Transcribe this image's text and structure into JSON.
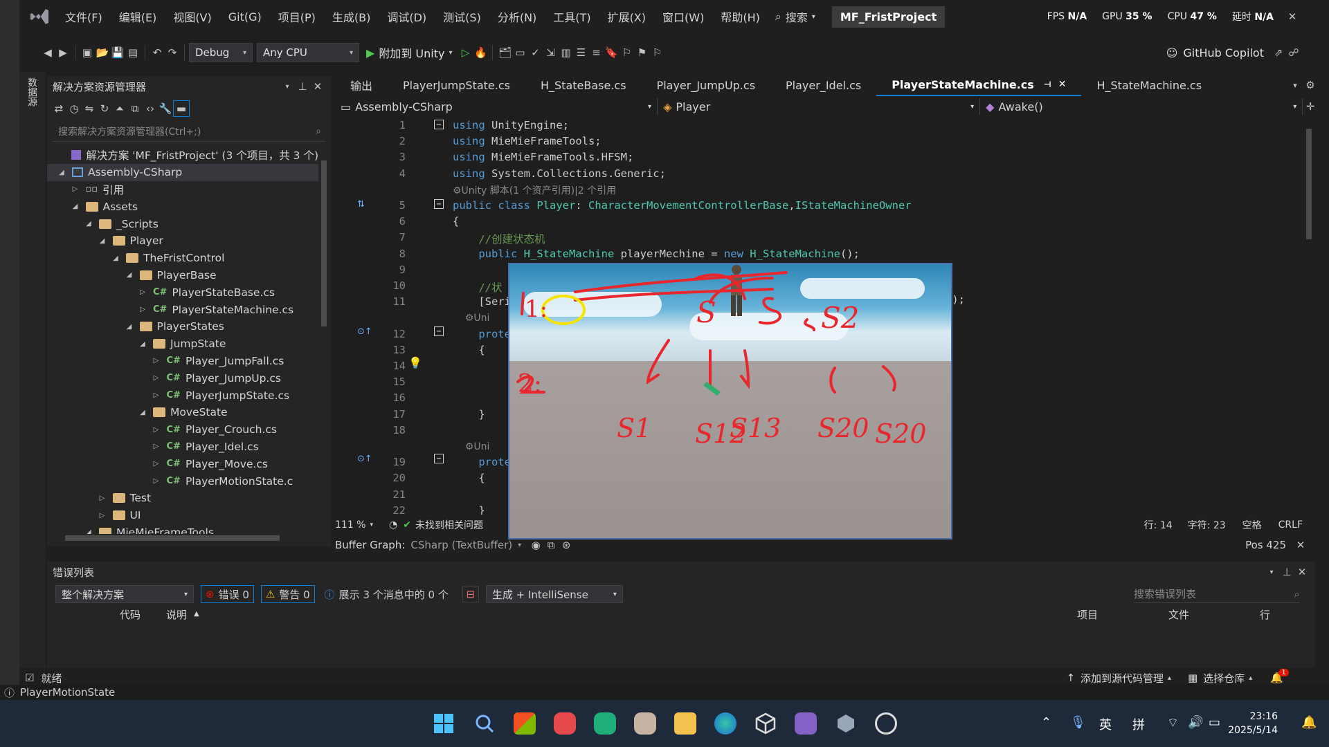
{
  "menubar": {
    "items": [
      "文件(F)",
      "编辑(E)",
      "视图(V)",
      "Git(G)",
      "项目(P)",
      "生成(B)",
      "调试(D)",
      "测试(S)",
      "分析(N)",
      "工具(T)",
      "扩展(X)",
      "窗口(W)",
      "帮助(H)"
    ],
    "search_label": "搜索",
    "project_name": "MF_FristProject",
    "perf": {
      "fps_label": "FPS",
      "fps": "N/A",
      "gpu_label": "GPU",
      "gpu": "35 %",
      "cpu_label": "CPU",
      "cpu": "47 %",
      "latency_label": "延时",
      "latency": "N/A"
    }
  },
  "toolbar": {
    "configuration": "Debug",
    "platform": "Any CPU",
    "attach_label": "附加到 Unity",
    "copilot_label": "GitHub Copilot"
  },
  "toolstrip": {
    "label": "数据源"
  },
  "solution_explorer": {
    "title": "解决方案资源管理器",
    "search_placeholder": "搜索解决方案资源管理器(Ctrl+;)",
    "tree": [
      {
        "label": "解决方案 'MF_FristProject' (3 个项目，共 3 个)",
        "depth": 0,
        "kind": "solution",
        "exp": ""
      },
      {
        "label": "Assembly-CSharp",
        "depth": 0,
        "kind": "project",
        "exp": "open",
        "selected": true
      },
      {
        "label": "引用",
        "depth": 1,
        "kind": "ref",
        "exp": "closed"
      },
      {
        "label": "Assets",
        "depth": 1,
        "kind": "folder",
        "exp": "open"
      },
      {
        "label": "_Scripts",
        "depth": 2,
        "kind": "folder",
        "exp": "open"
      },
      {
        "label": "Player",
        "depth": 3,
        "kind": "folder",
        "exp": "open"
      },
      {
        "label": "TheFristControl",
        "depth": 4,
        "kind": "folder",
        "exp": "open"
      },
      {
        "label": "PlayerBase",
        "depth": 5,
        "kind": "folder",
        "exp": "open"
      },
      {
        "label": "PlayerStateBase.cs",
        "depth": 6,
        "kind": "cs",
        "exp": "closed"
      },
      {
        "label": "PlayerStateMachine.cs",
        "depth": 6,
        "kind": "cs",
        "exp": "closed"
      },
      {
        "label": "PlayerStates",
        "depth": 5,
        "kind": "folder",
        "exp": "open"
      },
      {
        "label": "JumpState",
        "depth": 6,
        "kind": "folder",
        "exp": "open"
      },
      {
        "label": "Player_JumpFall.cs",
        "depth": 7,
        "kind": "cs",
        "exp": "closed"
      },
      {
        "label": "Player_JumpUp.cs",
        "depth": 7,
        "kind": "cs",
        "exp": "closed"
      },
      {
        "label": "PlayerJumpState.cs",
        "depth": 7,
        "kind": "cs",
        "exp": "closed"
      },
      {
        "label": "MoveState",
        "depth": 6,
        "kind": "folder",
        "exp": "open"
      },
      {
        "label": "Player_Crouch.cs",
        "depth": 7,
        "kind": "cs",
        "exp": "closed"
      },
      {
        "label": "Player_Idel.cs",
        "depth": 7,
        "kind": "cs",
        "exp": "closed"
      },
      {
        "label": "Player_Move.cs",
        "depth": 7,
        "kind": "cs",
        "exp": "closed"
      },
      {
        "label": "PlayerMotionState.c",
        "depth": 7,
        "kind": "cs",
        "exp": "closed"
      },
      {
        "label": "Test",
        "depth": 3,
        "kind": "folder",
        "exp": "closed"
      },
      {
        "label": "UI",
        "depth": 3,
        "kind": "folder",
        "exp": "closed"
      },
      {
        "label": "MieMieFrameTools",
        "depth": 2,
        "kind": "folder",
        "exp": "open"
      }
    ]
  },
  "editor": {
    "tabs": [
      {
        "label": "输出",
        "active": false
      },
      {
        "label": "PlayerJumpState.cs",
        "active": false
      },
      {
        "label": "H_StateBase.cs",
        "active": false
      },
      {
        "label": "Player_JumpUp.cs",
        "active": false
      },
      {
        "label": "Player_Idel.cs",
        "active": false
      },
      {
        "label": "PlayerStateMachine.cs",
        "active": true
      },
      {
        "label": "H_StateMachine.cs",
        "active": false
      }
    ],
    "nav": {
      "project": "Assembly-CSharp",
      "type": "Player",
      "member": "Awake()"
    },
    "code_lines": [
      {
        "num": "1",
        "html_parts": [
          [
            "kw",
            "using "
          ],
          [
            "",
            "UnityEngine;"
          ]
        ]
      },
      {
        "num": "2",
        "html_parts": [
          [
            "kw",
            "using "
          ],
          [
            "",
            "MieMieFrameTools;"
          ]
        ]
      },
      {
        "num": "3",
        "html_parts": [
          [
            "kw",
            "using "
          ],
          [
            "",
            "MieMieFrameTools.HFSM;"
          ]
        ]
      },
      {
        "num": "4",
        "html_parts": [
          [
            "kw",
            "using "
          ],
          [
            "",
            "System.Collections.Generic;"
          ]
        ]
      },
      {
        "num": "",
        "html_parts": [
          [
            "dim",
            "⚙Unity 脚本(1 个资产引用)|2 个引用"
          ]
        ]
      },
      {
        "num": "5",
        "html_parts": [
          [
            "kw",
            "public class "
          ],
          [
            "ty",
            "Player"
          ],
          [
            "",
            ": "
          ],
          [
            "ty",
            "CharacterMovementControllerBase"
          ],
          [
            "",
            ","
          ],
          [
            "ty",
            "IStateMachineOwner"
          ]
        ]
      },
      {
        "num": "6",
        "html_parts": [
          [
            "",
            "{"
          ]
        ]
      },
      {
        "num": "7",
        "html_parts": [
          [
            "cm",
            "    //创建状态机"
          ]
        ]
      },
      {
        "num": "8",
        "html_parts": [
          [
            "kw",
            "    public "
          ],
          [
            "ty",
            "H_StateMachine"
          ],
          [
            "",
            " playerMechine = "
          ],
          [
            "kw",
            "new "
          ],
          [
            "ty",
            "H_StateMachine"
          ],
          [
            "",
            "();"
          ]
        ]
      },
      {
        "num": "9",
        "html_parts": [
          [
            "",
            ""
          ]
        ]
      },
      {
        "num": "10",
        "html_parts": [
          [
            "cm",
            "    //状"
          ]
        ]
      },
      {
        "num": "11",
        "html_parts": [
          [
            "",
            "    [Seri"
          ]
        ]
      },
      {
        "num": "",
        "html_parts": [
          [
            "dim",
            "    ⚙Uni"
          ]
        ]
      },
      {
        "num": "12",
        "html_parts": [
          [
            "kw",
            "    prote"
          ]
        ]
      },
      {
        "num": "13",
        "html_parts": [
          [
            "",
            "    {"
          ]
        ]
      },
      {
        "num": "14",
        "html_parts": [
          [
            "",
            "        "
          ]
        ]
      },
      {
        "num": "15",
        "html_parts": [
          [
            "",
            "        "
          ]
        ]
      },
      {
        "num": "16",
        "html_parts": [
          [
            "",
            "        "
          ]
        ]
      },
      {
        "num": "17",
        "html_parts": [
          [
            "",
            "    }"
          ]
        ]
      },
      {
        "num": "18",
        "html_parts": [
          [
            "",
            ""
          ]
        ]
      },
      {
        "num": "",
        "html_parts": [
          [
            "dim",
            "    ⚙Uni"
          ]
        ]
      },
      {
        "num": "19",
        "html_parts": [
          [
            "kw",
            "    prote"
          ]
        ]
      },
      {
        "num": "20",
        "html_parts": [
          [
            "",
            "    {"
          ]
        ]
      },
      {
        "num": "21",
        "html_parts": [
          [
            "",
            "        "
          ]
        ]
      },
      {
        "num": "22",
        "html_parts": [
          [
            "",
            "    }"
          ]
        ]
      }
    ],
    "line11_tail": "();",
    "status": {
      "zoom": "111 %",
      "issues": "未找到相关问题",
      "line": "行: 14",
      "char": "字符: 23",
      "spaces": "空格",
      "eol": "CRLF"
    },
    "buffer_label": "Buffer Graph:",
    "buffer_value": "CSharp (TextBuffer)",
    "pos": "Pos 425"
  },
  "overlay": {
    "annotations": [
      "1:",
      "2:",
      "S",
      "S2",
      "S1",
      "S12",
      "S13",
      "S20",
      "S20"
    ]
  },
  "error_list": {
    "title": "错误列表",
    "scope": "整个解决方案",
    "errors": "错误 0",
    "warnings": "警告 0",
    "messages": "展示 3 个消息中的 0 个",
    "build_filter": "生成 + IntelliSense",
    "search_placeholder": "搜索错误列表",
    "columns": [
      "代码",
      "说明",
      "项目",
      "文件",
      "行"
    ]
  },
  "statusbar": {
    "ready": "就绪",
    "add_source_control": "添加到源代码管理",
    "select_repo": "选择仓库",
    "notif_count": "1"
  },
  "infobar": {
    "text": "PlayerMotionState"
  },
  "taskbar": {
    "ime1": "英",
    "ime2": "拼",
    "time": "23:16",
    "date": "2025/5/14"
  },
  "colors": {
    "accent": "#0e7fd6",
    "annotation_red": "#e8262b",
    "annotation_yellow": "#f5e400"
  }
}
